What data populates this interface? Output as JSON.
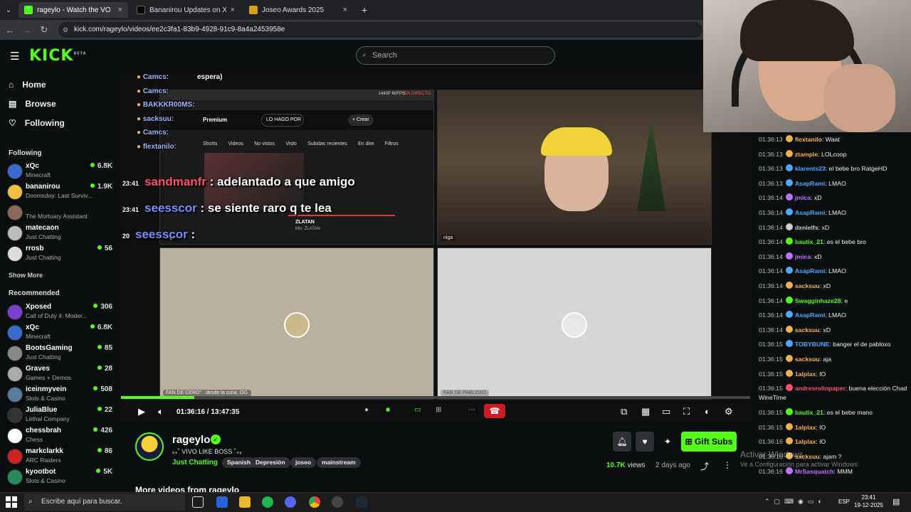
{
  "tabs": [
    {
      "title": "rageylo - Watch the VOD on Ki",
      "color": "#53fc18",
      "close": "×"
    },
    {
      "title": "Bananirou Updates on X: \"\"Ban",
      "color": "#000000",
      "close": "×"
    },
    {
      "title": "Joseo Awards 2025",
      "color": "#d4a017",
      "close": "×"
    }
  ],
  "new_tab": "+",
  "url": "kick.com/rageylo/videos/ee2c3fa1-83b9-4928-91c9-8a4a2453958e",
  "logo": "KICK",
  "logo_sup": "BETA",
  "search_placeholder": "Search",
  "nav": {
    "home": "Home",
    "browse": "Browse",
    "following": "Following"
  },
  "sections": {
    "following": "Following",
    "recommended": "Recommended",
    "show_more": "Show More"
  },
  "following_channels": [
    {
      "name": "xQc",
      "category": "Minecraft",
      "viewers": "6.8K",
      "color": "#3a6bd1"
    },
    {
      "name": "bananirou",
      "category": "Doomsday: Last Surviv...",
      "viewers": "1.9K",
      "color": "#f0c040"
    },
    {
      "name": "",
      "category": "The Mortuary Assistant",
      "viewers": "",
      "color": "#8a6a5a"
    },
    {
      "name": "matecaon",
      "category": "Just Chatting",
      "viewers": "",
      "color": "#bbbbbb"
    },
    {
      "name": "rrosb",
      "category": "Just Chatting",
      "viewers": "56",
      "color": "#dddddd"
    }
  ],
  "recommended_channels": [
    {
      "name": "Xposed",
      "category": "Call of Duty 4: Moder...",
      "viewers": "306",
      "color": "#7a3fd1"
    },
    {
      "name": "xQc",
      "category": "Minecraft",
      "viewers": "6.8K",
      "color": "#3a6bd1"
    },
    {
      "name": "BootsGaming",
      "category": "Just Chatting",
      "viewers": "85",
      "color": "#888888"
    },
    {
      "name": "Graves",
      "category": "Games + Demos",
      "viewers": "28",
      "color": "#aaaaaa"
    },
    {
      "name": "iceinmyvein",
      "category": "Slots & Casino",
      "viewers": "508",
      "color": "#5a7aa0"
    },
    {
      "name": "JuliaBlue",
      "category": "Lethal Company",
      "viewers": "22",
      "color": "#333333"
    },
    {
      "name": "chessbrah",
      "category": "Chess",
      "viewers": "426",
      "color": "#ffffff"
    },
    {
      "name": "markclarkk",
      "category": "ARC Raiders",
      "viewers": "86",
      "color": "#cc2222"
    },
    {
      "name": "kyootbot",
      "category": "Slots & Casino",
      "viewers": "5K",
      "color": "#2a8a5a"
    }
  ],
  "overlay_chat": [
    {
      "user": "Camcs:",
      "text": "espera)"
    },
    {
      "user": "Camcs:",
      "text": ""
    },
    {
      "user": "BAKKKR00MS:",
      "text": ""
    },
    {
      "user": "sacksuu:",
      "text": ""
    },
    {
      "user": "Camcs:",
      "text": ""
    },
    {
      "user": "flextanilo:",
      "text": ""
    }
  ],
  "big_overlay": [
    {
      "prefix": "23:41",
      "user": "sandmanfr",
      "text": " : adelantado a que amigo"
    },
    {
      "prefix": "23:41",
      "user": "seesscor",
      "text": " : se siente raro q te lea"
    },
    {
      "prefix": "20",
      "user": "seesscor",
      "text": " :"
    }
  ],
  "youtube_pane": {
    "premium": "Premium",
    "query": "LO HAGO POR",
    "create": "+ Crear",
    "chips": [
      "Shorts",
      "Videos",
      "No vistos",
      "Visto",
      "Subidas recientes",
      "En dire"
    ],
    "filters": "Filtros",
    "track": "ZLATAN",
    "track_sub": "Mix: ZLATAN",
    "quality": "1440P 60FPS",
    "live": "EN DIRECTO",
    "label": "niga"
  },
  "pane_labels": {
    "p2": "niga",
    "p3": "FAN DE CERO\" · desde la cuna. OG.",
    "p4": "FAN DE PABLOXO"
  },
  "controls": {
    "time": "01:36:16 / 13:47:35",
    "progress": 0.116
  },
  "channel": {
    "name": "rageylo",
    "tagline": "ₓ₊˚ VIVO LIKE BOSS ˚₊ₓ",
    "category": "Just Chatting",
    "tags": [
      "Spanish",
      "Depresión",
      "joseo",
      "mainstream"
    ],
    "gift": "Gift Subs",
    "views": "10.7K",
    "views_label": "views",
    "ago": "2 days ago"
  },
  "more_videos": "More videos from rageylo",
  "chat": [
    {
      "ts": "01:36:13",
      "user": "flextanilo",
      "color": "#f0b050",
      "text": ": Waat"
    },
    {
      "ts": "01:36:13",
      "user": "ztample",
      "color": "#f0b050",
      "text": ": LOLcoop"
    },
    {
      "ts": "01:36:13",
      "user": "klarents23",
      "color": "#4aa8ff",
      "text": ": el bebe bro RatgeHD"
    },
    {
      "ts": "01:36:13",
      "user": "AsapRami",
      "color": "#4aa8ff",
      "text": ": LMAO"
    },
    {
      "ts": "01:36:14",
      "user": "jmica",
      "color": "#c070ff",
      "text": ": xD"
    },
    {
      "ts": "01:36:14",
      "user": "AsapRami",
      "color": "#4aa8ff",
      "text": ": LMAO"
    },
    {
      "ts": "01:36:14",
      "user": "dxnielfs",
      "color": "#cccccc",
      "text": ": xD"
    },
    {
      "ts": "01:36:14",
      "user": "bautix_21",
      "color": "#53fc18",
      "text": ": es el bebe bro"
    },
    {
      "ts": "01:36:14",
      "user": "jmica",
      "color": "#c070ff",
      "text": ": xD"
    },
    {
      "ts": "01:36:14",
      "user": "AsapRami",
      "color": "#4aa8ff",
      "text": ": LMAO"
    },
    {
      "ts": "01:36:14",
      "user": "sacksuu",
      "color": "#f0b050",
      "text": ": xD"
    },
    {
      "ts": "01:36:14",
      "user": "Swagginhaze28",
      "color": "#53fc18",
      "text": ": e"
    },
    {
      "ts": "01:36:14",
      "user": "AsapRami",
      "color": "#4aa8ff",
      "text": ": LMAO"
    },
    {
      "ts": "01:36:14",
      "user": "sacksuu",
      "color": "#f0b050",
      "text": ": xD"
    },
    {
      "ts": "01:36:15",
      "user": "TOBYBUNE",
      "color": "#4aa8ff",
      "text": ": banger el de pabloxo"
    },
    {
      "ts": "01:36:15",
      "user": "sacksuu",
      "color": "#f0b050",
      "text": ": aja"
    },
    {
      "ts": "01:36:15",
      "user": "1alplax",
      "color": "#f0b050",
      "text": ": IO"
    },
    {
      "ts": "01:36:15",
      "user": "andresrolinpaper",
      "color": "#ff4d6d",
      "text": ": buena elección Chad WineTime"
    },
    {
      "ts": "01:36:15",
      "user": "bautix_21",
      "color": "#53fc18",
      "text": ": es el bebe mano"
    },
    {
      "ts": "01:36:15",
      "user": "1alplax",
      "color": "#f0b050",
      "text": ": IO"
    },
    {
      "ts": "01:36:16",
      "user": "1alplax",
      "color": "#f0b050",
      "text": ": IO"
    },
    {
      "ts": "01:36:16",
      "user": "sacksuu",
      "color": "#f0b050",
      "text": ": ajam ?"
    },
    {
      "ts": "01:36:16",
      "user": "MrSasquatch",
      "color": "#c070ff",
      "text": ": MMM"
    }
  ],
  "windows_activate": {
    "line1": "Activar Windows",
    "line2": "Ve a Configuración para activar Windows."
  },
  "taskbar": {
    "search": "Escribe aquí para buscar.",
    "lang": "ESP",
    "time": "23:41",
    "date": "19-12-2025"
  },
  "colors": {
    "kick_green": "#53fc18",
    "bg": "#0b0e0f"
  }
}
